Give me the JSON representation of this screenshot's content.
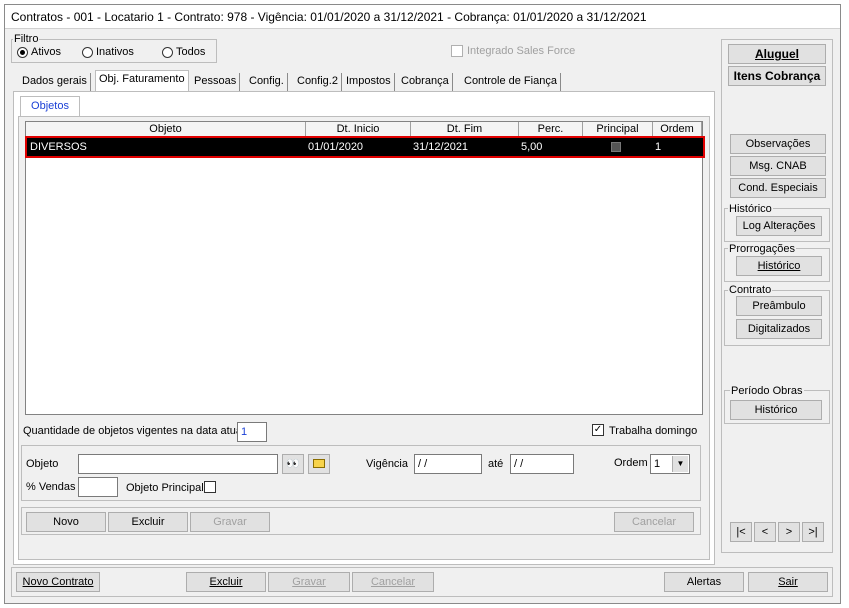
{
  "window": {
    "title": "Contratos - 001 - Locatario 1 - Contrato: 978 - Vigência: 01/01/2020 a 31/12/2021 - Cobrança: 01/01/2020 a 31/12/2021"
  },
  "filter": {
    "legend": "Filtro",
    "options": [
      "Ativos",
      "Inativos",
      "Todos"
    ],
    "selected": "Ativos",
    "integrado_label": "Integrado Sales Force"
  },
  "tabs": [
    "Dados gerais",
    "Obj. Faturamento",
    "Pessoas",
    "Config.",
    "Config.2",
    "Impostos",
    "Cobrança",
    "Controle de Fiança"
  ],
  "active_tab": "Obj. Faturamento",
  "subtab": "Objetos",
  "grid": {
    "columns": [
      "Objeto",
      "Dt. Inicio",
      "Dt. Fim",
      "Perc.",
      "Principal",
      "Ordem"
    ],
    "rows": [
      {
        "objeto": "DIVERSOS",
        "inicio": "01/01/2020",
        "fim": "31/12/2021",
        "perc": "5,00",
        "principal": true,
        "ordem": "1"
      }
    ]
  },
  "summary": {
    "quantidade_label": "Quantidade de objetos vigentes na data atual",
    "quantidade_value": "1",
    "trabalha_domingo_label": "Trabalha domingo",
    "trabalha_domingo_checked": true
  },
  "form": {
    "objeto_label": "Objeto",
    "objeto_value": "",
    "vigencia_label": "Vigência",
    "vigencia_from": " / /",
    "ate_label": "até",
    "vigencia_to": " / /",
    "ordem_label": "Ordem",
    "ordem_value": "1",
    "vendas_label": "% Vendas",
    "vendas_value": "",
    "objeto_principal_label": "Objeto Principal"
  },
  "inner_buttons": {
    "novo": "Novo",
    "excluir": "Excluir",
    "gravar": "Gravar",
    "cancelar": "Cancelar"
  },
  "bottom_buttons": {
    "novo_contrato": "Novo Contrato",
    "excluir": "Excluir",
    "gravar": "Gravar",
    "cancelar": "Cancelar",
    "alertas": "Alertas",
    "sair": "Sair"
  },
  "side": {
    "aluguel": "Aluguel",
    "itens_cobranca": "Itens Cobrança",
    "observacoes": "Observações",
    "msg_cnab": "Msg. CNAB",
    "cond_especiais": "Cond. Especiais",
    "historico_legend": "Histórico",
    "log_alteracoes": "Log Alterações",
    "prorrogacoes_legend": "Prorrogações",
    "historico_btn": "Histórico",
    "contrato_legend": "Contrato",
    "preambulo": "Preâmbulo",
    "digitalizados": "Digitalizados",
    "periodo_obras_legend": "Período Obras",
    "periodo_historico": "Histórico"
  },
  "nav": [
    "|<",
    "<",
    ">",
    ">|"
  ],
  "colors": {
    "selection_bg": "#000000",
    "highlight_border": "#e00000",
    "tab_active_text": "#1a3fd6"
  }
}
